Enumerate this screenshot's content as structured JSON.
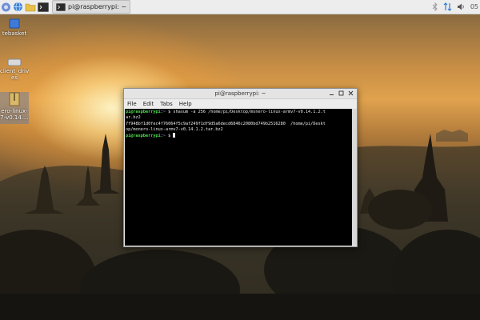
{
  "panel": {
    "menu_icon": "raspberry-icon",
    "taskbar": [
      {
        "icon": "globe-icon"
      },
      {
        "icon": "folder-icon"
      },
      {
        "icon": "terminal-icon"
      }
    ],
    "active_task": {
      "icon": "terminal-icon",
      "label": "pi@raspberrypi: ~"
    },
    "tray": {
      "bluetooth_icon": "bluetooth-icon",
      "network_icon": "network-arrows-icon",
      "volume_icon": "volume-icon",
      "clock": "05"
    }
  },
  "desktop": {
    "icons": [
      {
        "label": "Wastebasket",
        "visible": "tebasket",
        "icon": "trash-icon"
      },
      {
        "label_line1": "client_driv",
        "label_line2": "es",
        "icon": "drive-icon"
      },
      {
        "label_line1": "ero-linux-",
        "label_line2": "7-v0.14....",
        "icon": "archive-icon"
      }
    ]
  },
  "terminal": {
    "title": "pi@raspberrypi: ~",
    "menu": [
      "File",
      "Edit",
      "Tabs",
      "Help"
    ],
    "lines": [
      {
        "user": "pi@raspberrypi",
        "sep": ":",
        "path": "~",
        "rest": " $ shasum -a 256 /home/pi/Desktop/monero-linux-armv7-v0.14.1.2.t"
      },
      {
        "text": "ar.bz2"
      },
      {
        "text": "7f948bf1d0fec4f76064f5c9af249f1df9d5a6decd6846c2080bd749b2516280  /home/pi/Deskt"
      },
      {
        "text": "op/monero-linux-armv7-v0.14.1.2.tar.bz2"
      },
      {
        "user": "pi@raspberrypi",
        "sep": ":",
        "path": "~",
        "rest": " $ "
      }
    ]
  }
}
